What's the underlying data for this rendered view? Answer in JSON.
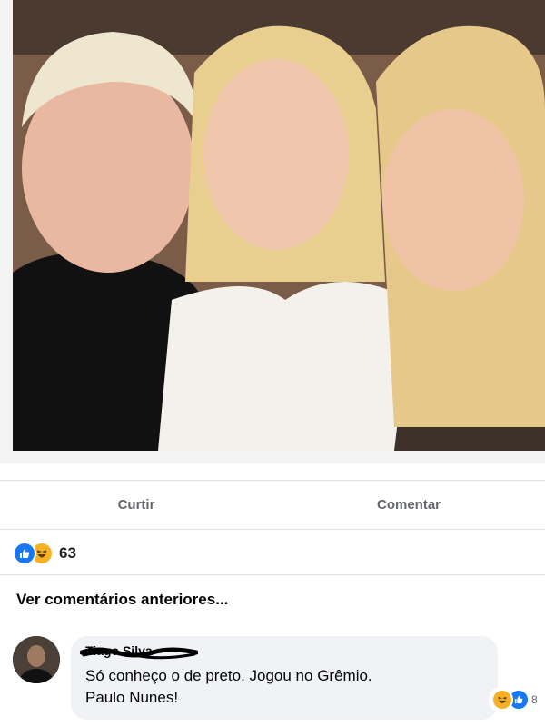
{
  "post": {
    "actions": {
      "like_label": "Curtir",
      "comment_label": "Comentar"
    },
    "reactions": {
      "icons": [
        "like-icon",
        "haha-icon"
      ],
      "count": "63"
    },
    "view_previous_label": "Ver comentários anteriores..."
  },
  "comment": {
    "author_redacted": "Tiago Silva",
    "text_line1": "Só conheço o de preto. Jogou no Grêmio.",
    "text_line2": "Paulo Nunes!",
    "reactions": {
      "icons": [
        "haha-icon",
        "like-icon"
      ],
      "count": "8"
    }
  },
  "colors": {
    "facebook_blue": "#1877f2",
    "haha_yellow": "#f7b125",
    "muted_text": "#65676b",
    "bubble_bg": "#f0f2f5"
  }
}
